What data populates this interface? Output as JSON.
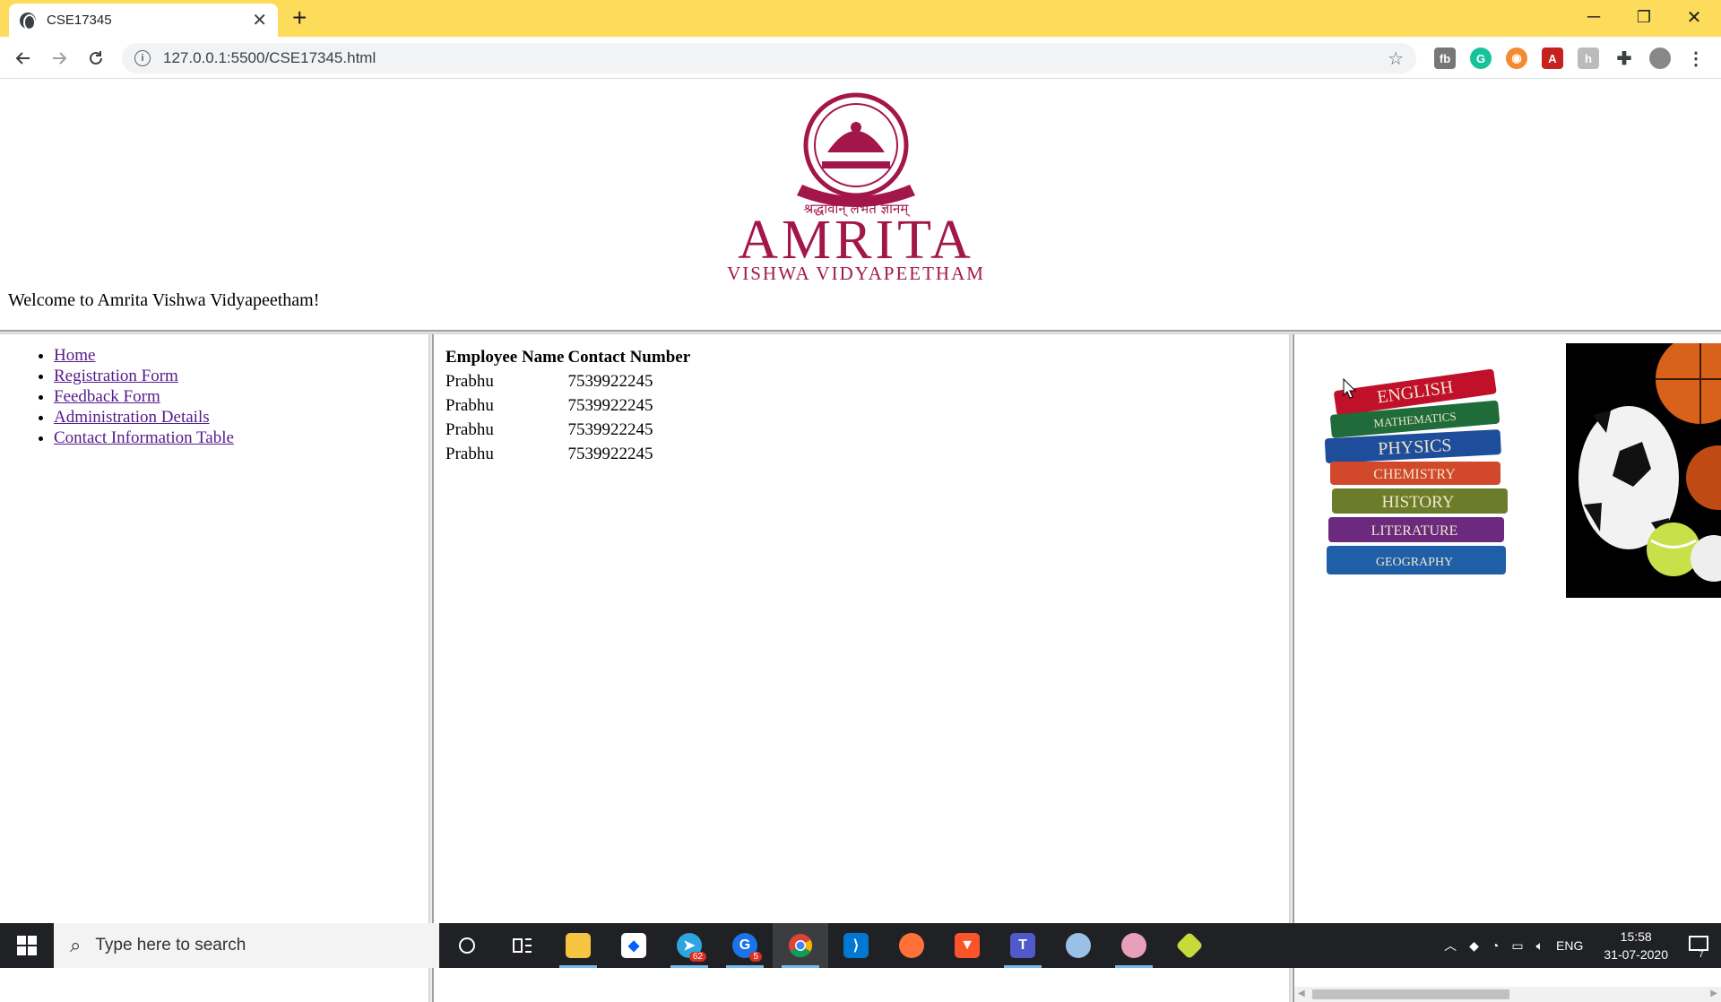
{
  "browser": {
    "tab_title": "CSE17345",
    "tab_close": "✕",
    "new_tab": "+",
    "url": "127.0.0.1:5500/CSE17345.html",
    "window_controls": {
      "minimize": "─",
      "restore": "❐",
      "close": "✕"
    }
  },
  "page": {
    "logo": {
      "seal_text": "श्रद्धावान् लभते ज्ञानम्",
      "name": "AMRITA",
      "subtitle": "VISHWA VIDYAPEETHAM",
      "brand_color": "#a3164a"
    },
    "welcome": "Welcome to Amrita Vishwa Vidyapeetham!",
    "nav": [
      {
        "label": "Home"
      },
      {
        "label": "Registration Form"
      },
      {
        "label": "Feedback Form"
      },
      {
        "label": "Administration Details"
      },
      {
        "label": "Contact Information Table"
      }
    ],
    "table": {
      "headers": [
        "Employee Name",
        "Contact Number"
      ],
      "rows": [
        [
          "Prabhu",
          "7539922245"
        ],
        [
          "Prabhu",
          "7539922245"
        ],
        [
          "Prabhu",
          "7539922245"
        ],
        [
          "Prabhu",
          "7539922245"
        ]
      ]
    },
    "books": [
      "ENGLISH",
      "MATHEMATICS",
      "PHYSICS",
      "CHEMISTRY",
      "HISTORY",
      "LITERATURE",
      "GEOGRAPHY"
    ]
  },
  "taskbar": {
    "search_placeholder": "Type here to search",
    "telegram_badge": "62",
    "chrome_alt_badge": "5",
    "language": "ENG",
    "time": "15:58",
    "date": "31-07-2020",
    "notifications": "7"
  }
}
